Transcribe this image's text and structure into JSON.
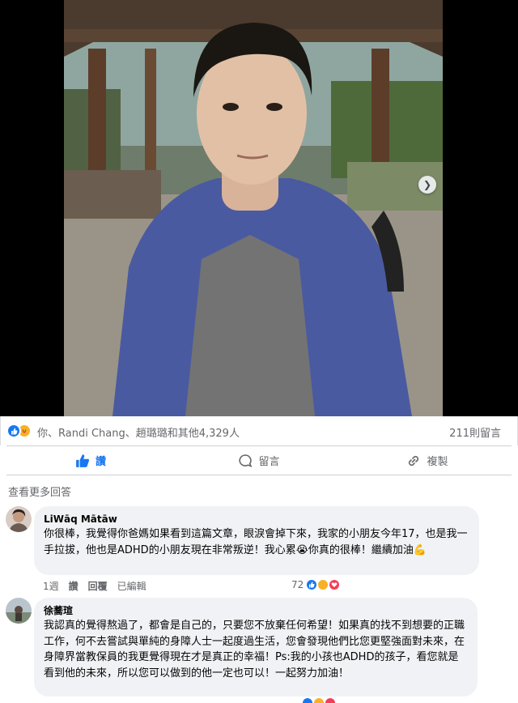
{
  "post": {
    "reactions_names": "你、Randi Chang、趙璐璐和其他4,329人",
    "comment_count": "211則留言",
    "reaction_types": [
      "like-icon",
      "care-icon"
    ]
  },
  "actions": {
    "like": "讚",
    "comment": "留言",
    "share": "複製"
  },
  "comments_section": {
    "more_replies": "查看更多回答",
    "comments": [
      {
        "author": "LiWāq Mātāw",
        "text": "你很棒，我覺得你爸媽如果看到這篇文章，眼淚會掉下來，我家的小朋友今年17，也是我一手拉拔，他也是ADHD的小朋友現在非常叛逆！我心累😭你真的很棒！繼續加油💪",
        "time": "1週",
        "like": "讚",
        "reply": "回覆",
        "edited": "已編輯",
        "reaction_count": "72",
        "reaction_types": [
          "like-icon",
          "care-icon",
          "love-icon"
        ]
      },
      {
        "author": "徐蕎瑄",
        "text": "我認真的覺得熬過了，都會是自己的，只要您不放棄任何希望！如果真的找不到想要的正職工作，何不去嘗試與單純的身障人士一起度過生活，您會發現他們比您更堅強面對未來，在身障界當教保員的我更覺得現在才是真正的幸福！Ps:我的小孩也ADHD的孩子，看您就是看到他的未來，所以您可以做到的他一定也可以！一起努力加油！"
      }
    ]
  },
  "colors": {
    "accent": "#1877f2",
    "bubble": "#f0f2f5",
    "secondary_text": "#65676b"
  }
}
